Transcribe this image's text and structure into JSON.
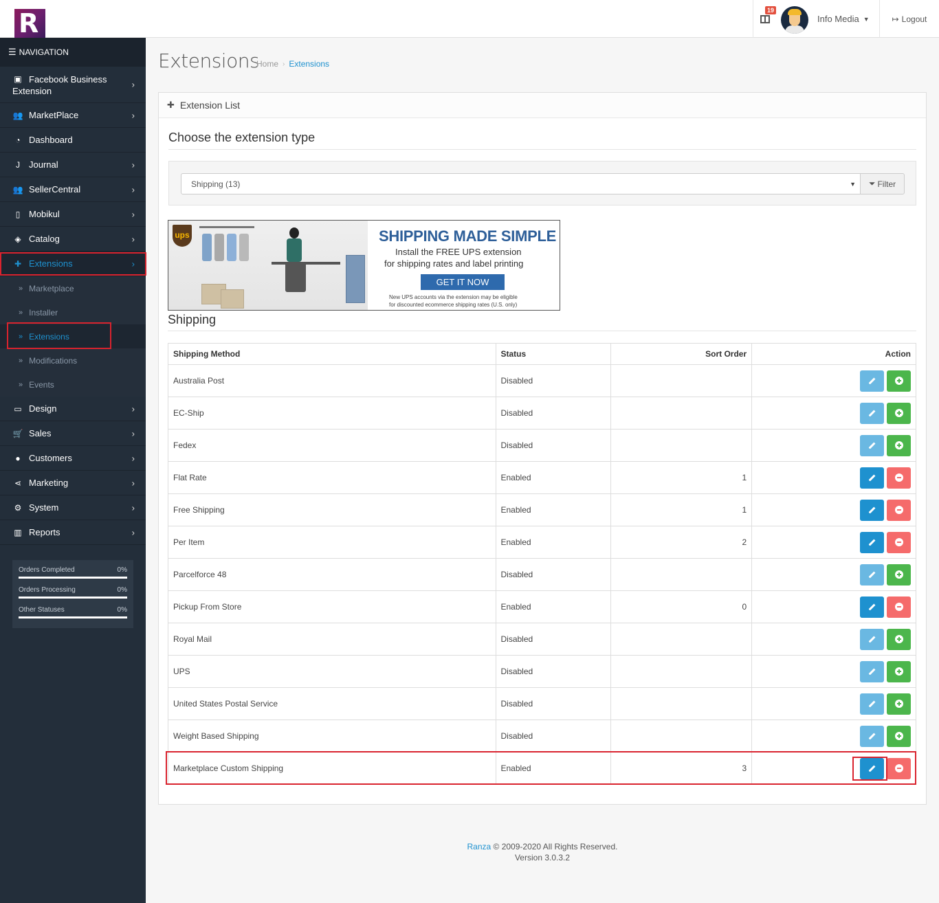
{
  "sidebar": {
    "logo_letter": "R",
    "nav_header": "NAVIGATION",
    "items": [
      {
        "label": "Facebook Business Extension",
        "icon": "facebook-icon"
      },
      {
        "label": "MarketPlace",
        "icon": "users-icon"
      },
      {
        "label": "Dashboard",
        "icon": "dashboard-icon"
      },
      {
        "label": "Journal",
        "icon": "journal-icon"
      },
      {
        "label": "SellerCentral",
        "icon": "users-icon"
      },
      {
        "label": "Mobikul",
        "icon": "mobile-icon"
      },
      {
        "label": "Catalog",
        "icon": "tags-icon"
      },
      {
        "label": "Extensions",
        "icon": "puzzle-icon"
      },
      {
        "label": "Design",
        "icon": "desktop-icon"
      },
      {
        "label": "Sales",
        "icon": "cart-icon"
      },
      {
        "label": "Customers",
        "icon": "user-icon"
      },
      {
        "label": "Marketing",
        "icon": "share-icon"
      },
      {
        "label": "System",
        "icon": "gear-icon"
      },
      {
        "label": "Reports",
        "icon": "bar-chart-icon"
      }
    ],
    "sub_items": [
      "Marketplace",
      "Installer",
      "Extensions",
      "Modifications",
      "Events"
    ],
    "stats": [
      {
        "label": "Orders Completed",
        "value": "0%"
      },
      {
        "label": "Orders Processing",
        "value": "0%"
      },
      {
        "label": "Other Statuses",
        "value": "0%"
      }
    ]
  },
  "header": {
    "notification_count": "19",
    "user_name": "Info Media",
    "logout_label": "Logout"
  },
  "page": {
    "title": "Extensions",
    "breadcrumb": [
      "Home",
      "Extensions"
    ]
  },
  "panel": {
    "heading": "Extension List",
    "choose_label": "Choose the extension type",
    "selected_type": "Shipping (13)",
    "filter_label": "Filter"
  },
  "ups_banner": {
    "logo_text": "ups",
    "title": "SHIPPING MADE SIMPLE",
    "line1": "Install the FREE UPS extension",
    "line2": "for shipping rates and label printing",
    "cta": "GET IT NOW",
    "note1": "New UPS accounts via the extension may be eligible",
    "note2": "for discounted ecommerce shipping rates (U.S. only)"
  },
  "shipping": {
    "title": "Shipping",
    "columns": [
      "Shipping Method",
      "Status",
      "Sort Order",
      "Action"
    ],
    "rows": [
      {
        "method": "Australia Post",
        "status": "Disabled",
        "sort": "",
        "installed": false
      },
      {
        "method": "EC-Ship",
        "status": "Disabled",
        "sort": "",
        "installed": false
      },
      {
        "method": "Fedex",
        "status": "Disabled",
        "sort": "",
        "installed": false
      },
      {
        "method": "Flat Rate",
        "status": "Enabled",
        "sort": "1",
        "installed": true
      },
      {
        "method": "Free Shipping",
        "status": "Enabled",
        "sort": "1",
        "installed": true
      },
      {
        "method": "Per Item",
        "status": "Enabled",
        "sort": "2",
        "installed": true
      },
      {
        "method": "Parcelforce 48",
        "status": "Disabled",
        "sort": "",
        "installed": false
      },
      {
        "method": "Pickup From Store",
        "status": "Enabled",
        "sort": "0",
        "installed": true
      },
      {
        "method": "Royal Mail",
        "status": "Disabled",
        "sort": "",
        "installed": false
      },
      {
        "method": "UPS",
        "status": "Disabled",
        "sort": "",
        "installed": false
      },
      {
        "method": "United States Postal Service",
        "status": "Disabled",
        "sort": "",
        "installed": false
      },
      {
        "method": "Weight Based Shipping",
        "status": "Disabled",
        "sort": "",
        "installed": false
      },
      {
        "method": "Marketplace Custom Shipping",
        "status": "Enabled",
        "sort": "3",
        "installed": true
      }
    ]
  },
  "footer": {
    "brand": "Ranza",
    "copyright": " © 2009-2020 All Rights Reserved.",
    "version": "Version 3.0.3.2"
  },
  "colors": {
    "sidebar_bg": "#232e3a",
    "accent": "#1e91cf",
    "highlight": "#d9232e",
    "install": "#4cb64c",
    "uninstall": "#f56b6b"
  }
}
